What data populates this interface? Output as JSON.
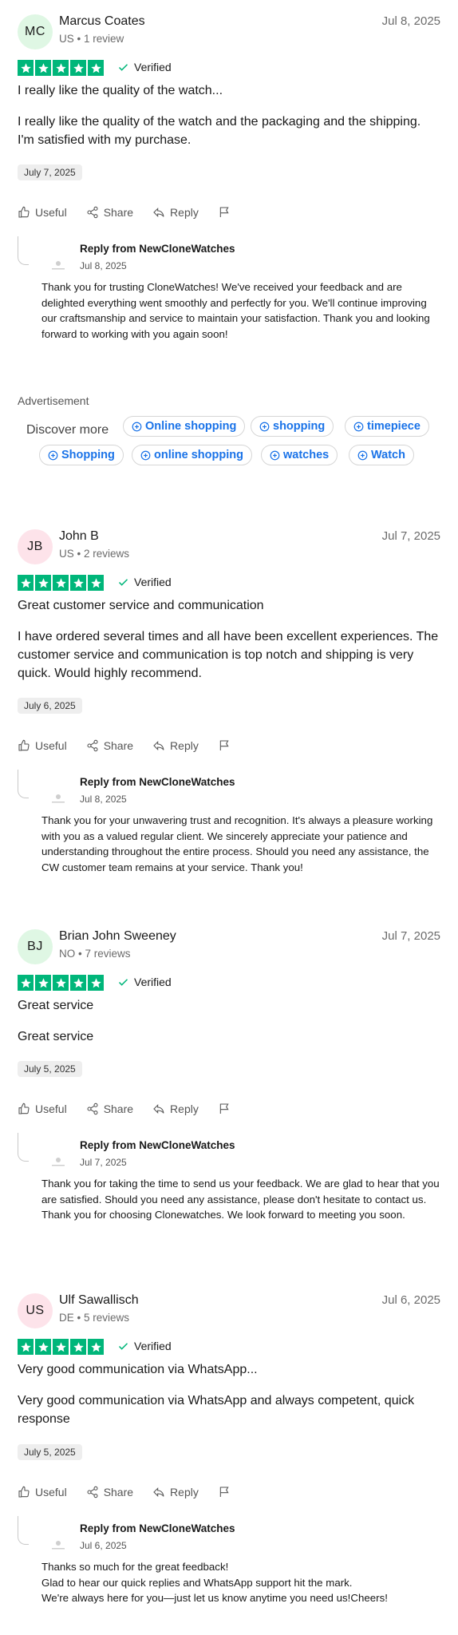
{
  "colors": {
    "star": "#00b67a",
    "verified_check": "#00b67a",
    "chip_text": "#1a73e8"
  },
  "common": {
    "useful": "Useful",
    "share": "Share",
    "reply": "Reply",
    "verified": "Verified",
    "useful_icon": "thumbs-up-icon",
    "share_icon": "share-icon",
    "reply_icon": "reply-arrow-icon",
    "flag_icon": "flag-icon"
  },
  "reviews": [
    {
      "initials": "MC",
      "avatar_color": "#dff7e4",
      "name": "Marcus Coates",
      "meta": "US • 1 review",
      "date": "Jul 8, 2025",
      "rating": 5,
      "title": "I really like the quality of the watch...",
      "body": "I really like the quality of the watch and the packaging and the shipping. I'm satisfied with my purchase.",
      "experience_date": "July 7, 2025",
      "reply": {
        "from": "Reply from NewCloneWatches",
        "date": "Jul 8, 2025",
        "text": "Thank you for trusting CloneWatches! We've received your feedback and are delighted everything went smoothly and perfectly for you. We'll continue improving our craftsmanship and service to maintain your satisfaction. Thank you and looking forward to working with you again soon!"
      }
    },
    {
      "initials": "JB",
      "avatar_color": "#fde3ea",
      "name": "John B",
      "meta": "US • 2 reviews",
      "date": "Jul 7, 2025",
      "rating": 5,
      "title": "Great customer service and communication",
      "body": "I have ordered several times and all have been excellent experiences. The customer service and communication is top notch and shipping is very quick. Would highly recommend.",
      "experience_date": "July 6, 2025",
      "reply": {
        "from": "Reply from NewCloneWatches",
        "date": "Jul 8, 2025",
        "text": "Thank you for your unwavering trust and recognition. It's always a pleasure working with you as a valued regular client. We sincerely appreciate your patience and understanding throughout the entire process. Should you need any assistance, the CW customer team remains at your service. Thank you!"
      }
    },
    {
      "initials": "BJ",
      "avatar_color": "#dff7e4",
      "name": "Brian John Sweeney",
      "meta": "NO • 7 reviews",
      "date": "Jul 7, 2025",
      "rating": 5,
      "title": "Great service",
      "body": "Great service",
      "experience_date": "July 5, 2025",
      "reply": {
        "from": "Reply from NewCloneWatches",
        "date": "Jul 7, 2025",
        "text": "Thank you for taking the time to send us your feedback. We are glad to hear that you are satisfied. Should you need any assistance, please don't hesitate to contact us. Thank you for choosing Clonewatches. We look forward to meeting you soon."
      }
    },
    {
      "initials": "US",
      "avatar_color": "#fde3ea",
      "name": "Ulf Sawallisch",
      "meta": "DE • 5 reviews",
      "date": "Jul 6, 2025",
      "rating": 5,
      "title": "Very good communication via WhatsApp...",
      "body": "Very good communication via WhatsApp and always competent, quick response",
      "experience_date": "July 5, 2025",
      "reply": {
        "from": "Reply from NewCloneWatches",
        "date": "Jul 6, 2025",
        "text": "Thanks so much for the great feedback!\nGlad to hear our quick replies and WhatsApp support hit the mark.\nWe're always here for you—just let us know anytime you need us!Cheers!"
      }
    }
  ],
  "advertisement": {
    "label": "Advertisement",
    "discover": "Discover more",
    "chips": [
      "Online shopping",
      "shopping",
      "timepiece",
      "Shopping",
      "online shopping",
      "watches",
      "Watch"
    ]
  }
}
